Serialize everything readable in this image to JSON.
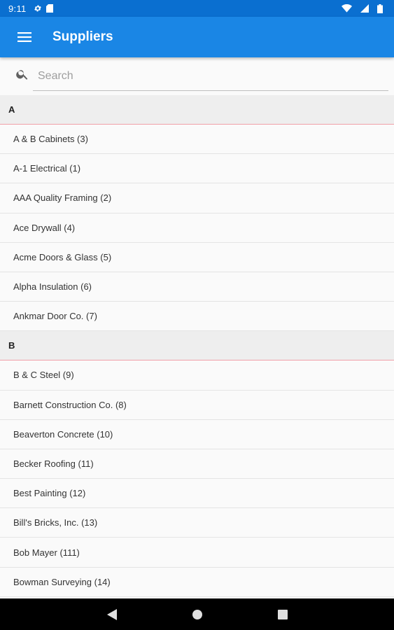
{
  "status_bar": {
    "time": "9:11"
  },
  "app_bar": {
    "title": "Suppliers",
    "color": "#1a86e5"
  },
  "search": {
    "placeholder": "Search",
    "value": ""
  },
  "sections": [
    {
      "letter": "A",
      "items": [
        "A & B Cabinets (3)",
        "A-1 Electrical (1)",
        "AAA Quality Framing (2)",
        "Ace Drywall (4)",
        "Acme Doors & Glass (5)",
        "Alpha Insulation (6)",
        "Ankmar Door Co. (7)"
      ]
    },
    {
      "letter": "B",
      "items": [
        "B & C Steel (9)",
        "Barnett Construction Co. (8)",
        "Beaverton Concrete (10)",
        "Becker Roofing (11)",
        "Best Painting (12)",
        "Bill's Bricks, Inc. (13)",
        "Bob Mayer (111)",
        "Bowman Surveying (14)"
      ]
    }
  ]
}
